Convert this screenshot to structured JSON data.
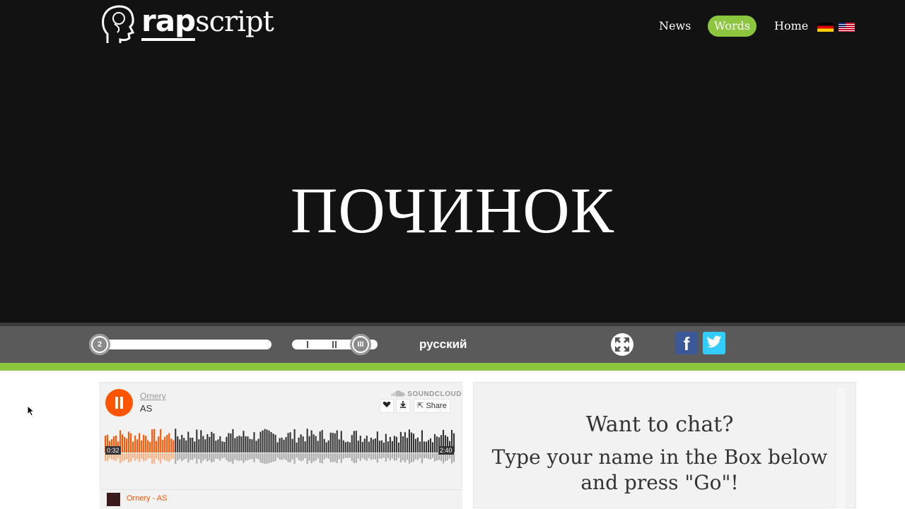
{
  "header": {
    "logo": {
      "bold": "rap",
      "light": "script"
    },
    "nav": [
      {
        "label": "News"
      },
      {
        "label": "Words",
        "active": true
      },
      {
        "label": "Home"
      }
    ],
    "flags": [
      "flag-de-icon",
      "flag-uk-icon"
    ]
  },
  "hero": {
    "word": "ПОЧИНОК"
  },
  "controls": {
    "slider1_value": "2",
    "language": "русский",
    "icons": [
      "expand-icon",
      "facebook-icon",
      "twitter-icon"
    ],
    "facebook_glyph": "f"
  },
  "soundcloud": {
    "user": "Ornery",
    "track_title": "AS",
    "brand": "SOUNDCLOUD",
    "share_label": "Share",
    "time_current": "0:32",
    "time_total": "2:40",
    "playlist_item": "Ornery - AS",
    "progress_fraction": 0.2,
    "accent_color": "#ff5500"
  },
  "chat": {
    "title": "Want to chat?",
    "line1": "Type your name in the Box below",
    "line2": "and press \"Go\"!"
  },
  "colors": {
    "accent": "#8cc63f",
    "background": "#121212"
  }
}
